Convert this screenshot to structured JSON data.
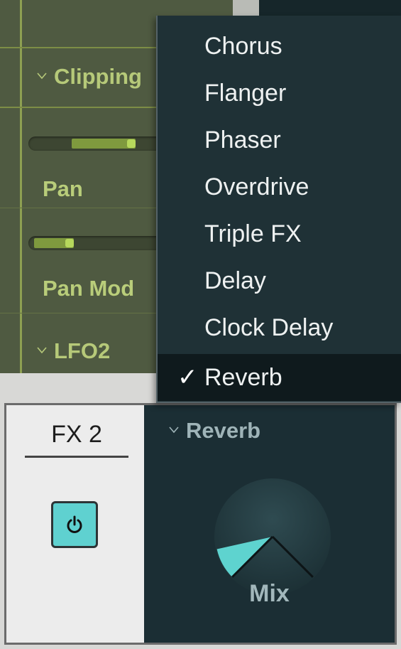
{
  "synth": {
    "sections": [
      {
        "label": "Clipping"
      },
      {
        "label": "LFO2"
      }
    ],
    "params": [
      {
        "label": "Pan",
        "level": 0.8
      },
      {
        "label": "Pan Mod",
        "level": 0.25
      }
    ]
  },
  "fx_menu": {
    "items": [
      {
        "label": "Chorus",
        "selected": false
      },
      {
        "label": "Flanger",
        "selected": false
      },
      {
        "label": "Phaser",
        "selected": false
      },
      {
        "label": "Overdrive",
        "selected": false
      },
      {
        "label": "Triple FX",
        "selected": false
      },
      {
        "label": "Delay",
        "selected": false
      },
      {
        "label": "Clock Delay",
        "selected": false
      },
      {
        "label": "Reverb",
        "selected": true
      }
    ],
    "checkmark": "✓"
  },
  "fx_panel": {
    "title": "FX 2",
    "power_icon": "power-icon",
    "power_on": true,
    "effect": "Reverb",
    "knob": {
      "label": "Mix",
      "value": 0.12
    }
  },
  "colors": {
    "accent_green": "#b6c979",
    "panel_green": "#4f5a41",
    "fx_dark": "#1b2e34",
    "power_cyan": "#5fd1d0"
  }
}
